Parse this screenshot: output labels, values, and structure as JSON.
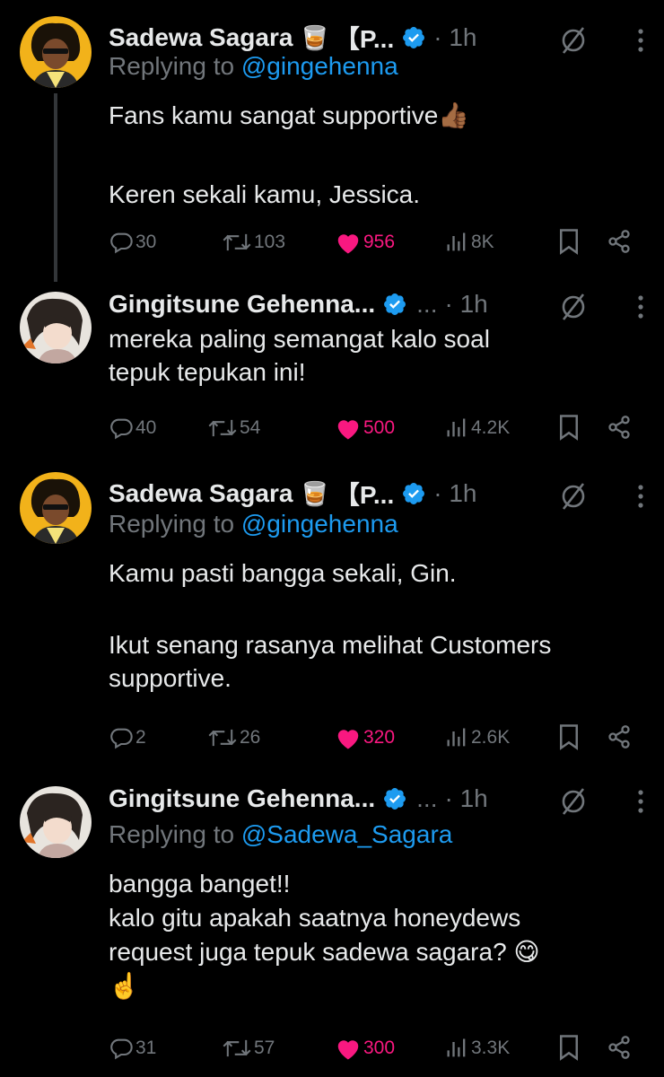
{
  "tweets": [
    {
      "author": "Sadewa Sagara",
      "emoji": "🥃",
      "bracket_text": "【P...",
      "ellipsis": "",
      "time": "· 1h",
      "replying_prefix": "Replying to ",
      "replying_handle": "@gingehenna",
      "body": [
        "Fans kamu sangat supportive👍🏾",
        "",
        "Keren sekali kamu, Jessica."
      ],
      "stats": {
        "replies": "30",
        "reposts": "103",
        "likes": "956",
        "views": "8K"
      }
    },
    {
      "author": "Gingitsune Gehenna...",
      "emoji": "",
      "bracket_text": "",
      "ellipsis": "...",
      "time": "· 1h",
      "replying_prefix": "",
      "replying_handle": "",
      "body": [
        "mereka paling semangat kalo soal",
        "tepuk tepukan ini!"
      ],
      "stats": {
        "replies": "40",
        "reposts": "54",
        "likes": "500",
        "views": "4.2K"
      }
    },
    {
      "author": "Sadewa Sagara",
      "emoji": "🥃",
      "bracket_text": "【P...",
      "ellipsis": "",
      "time": "· 1h",
      "replying_prefix": "Replying to ",
      "replying_handle": "@gingehenna",
      "body": [
        "Kamu pasti bangga sekali, Gin.",
        "",
        "Ikut senang rasanya melihat Customers",
        "supportive."
      ],
      "stats": {
        "replies": "2",
        "reposts": "26",
        "likes": "320",
        "views": "2.6K"
      }
    },
    {
      "author": "Gingitsune Gehenna...",
      "emoji": "",
      "bracket_text": "",
      "ellipsis": "...",
      "time": "· 1h",
      "replying_prefix": "Replying to ",
      "replying_handle": "@Sadewa_Sagara",
      "body": [
        "bangga banget!!",
        "kalo gitu apakah saatnya honeydews",
        "request juga tepuk sadewa sagara? 😋",
        "☝️"
      ],
      "stats": {
        "replies": "31",
        "reposts": "57",
        "likes": "300",
        "views": "3.3K"
      }
    }
  ],
  "colors": {
    "background": "#000000",
    "text": "#e7e9ea",
    "muted": "#71767b",
    "link": "#1d9bf0",
    "like": "#f91880",
    "verified": "#1d9bf0"
  },
  "icons": [
    "reply-icon",
    "repost-icon",
    "heart-icon",
    "views-icon",
    "bookmark-icon",
    "share-icon",
    "verified-badge-icon",
    "grok-slash-icon",
    "more-vertical-icon"
  ]
}
